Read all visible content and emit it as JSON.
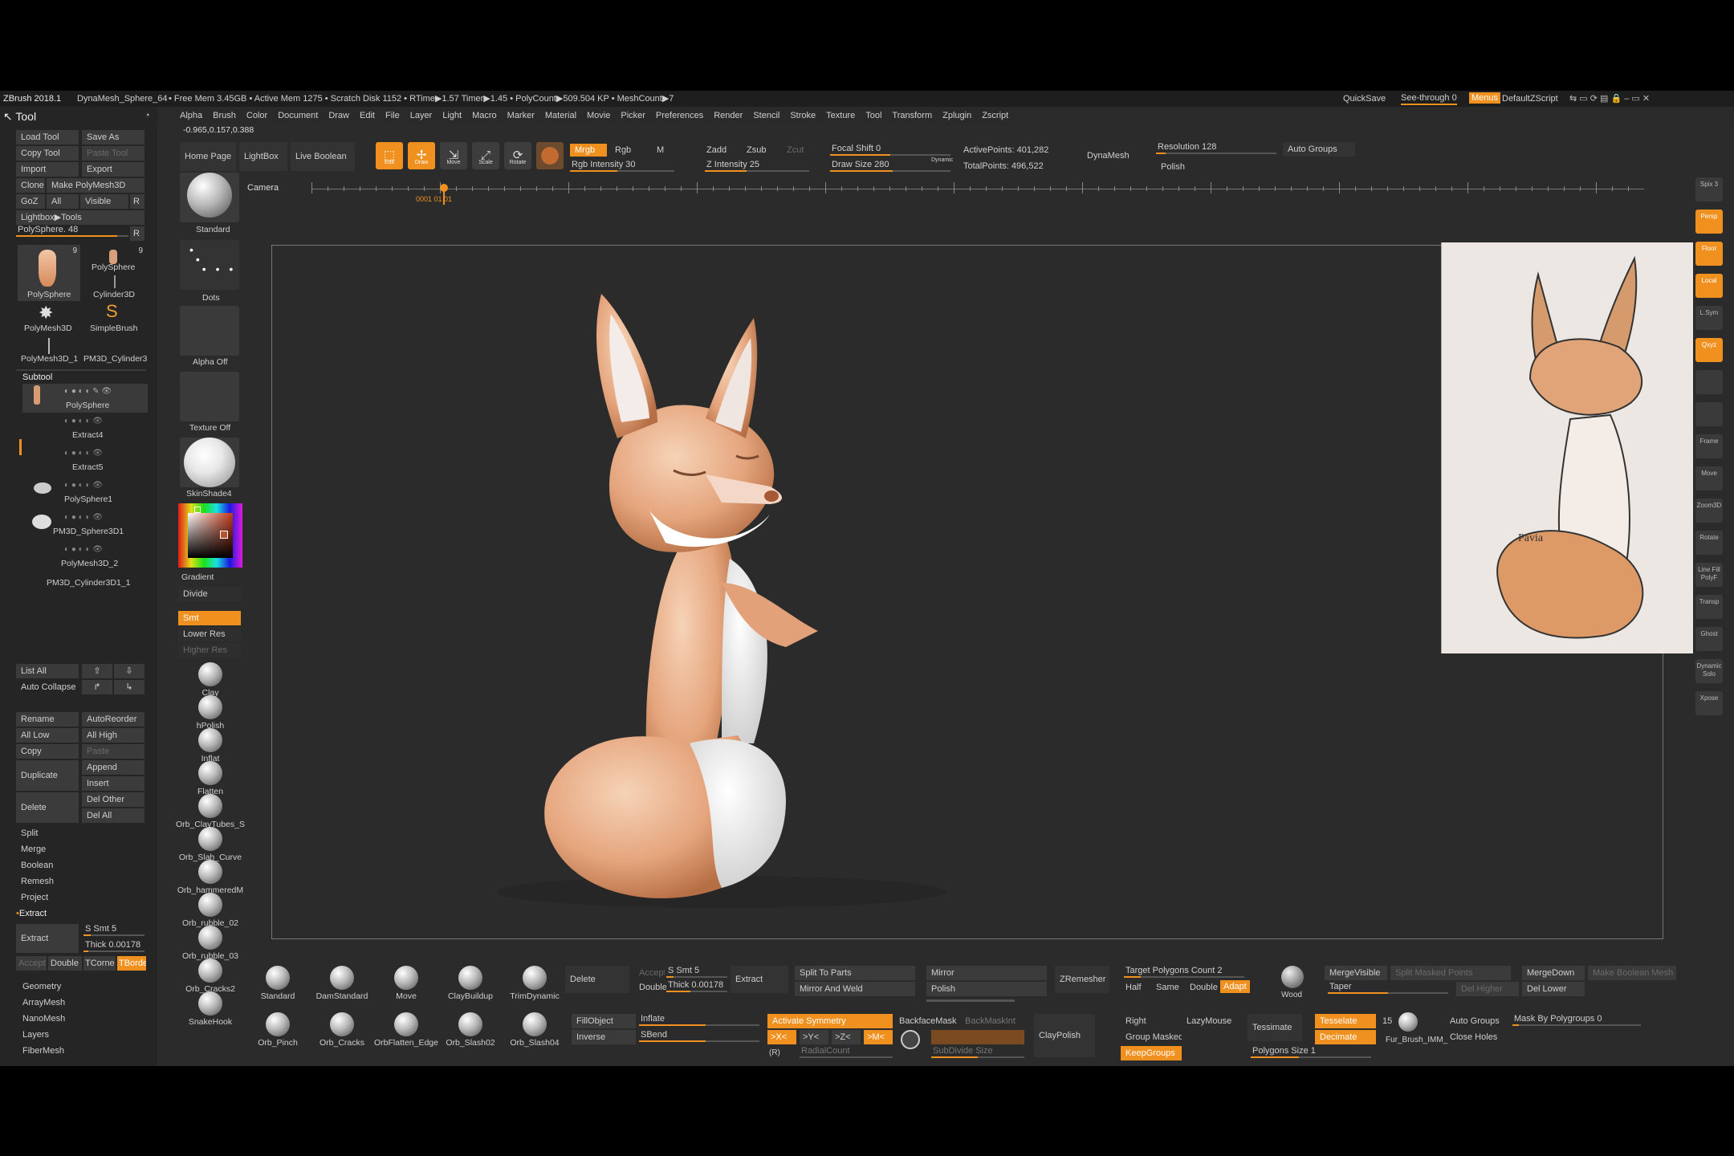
{
  "status": {
    "app": "ZBrush 2018.1",
    "file": "DynaMesh_Sphere_64",
    "stats": "• Free Mem 3.45GB • Active Mem 1275 • Scratch Disk 1152 • RTime▶1.57 Timer▶1.45 • PolyCount▶509.504 KP • MeshCount▶7",
    "quicksave": "QuickSave",
    "seethrough": "See-through",
    "seethrough_val": "0",
    "menus": "Menus",
    "script": "DefaultZScript"
  },
  "tool_title": "Tool",
  "coords": "-0.965,0.157,0.388",
  "menus": [
    "Alpha",
    "Brush",
    "Color",
    "Document",
    "Draw",
    "Edit",
    "File",
    "Layer",
    "Light",
    "Macro",
    "Marker",
    "Material",
    "Movie",
    "Picker",
    "Preferences",
    "Render",
    "Stencil",
    "Stroke",
    "Texture",
    "Tool",
    "Transform",
    "Zplugin",
    "Zscript"
  ],
  "left": {
    "load_tool": "Load Tool",
    "save_as": "Save As",
    "copy_tool": "Copy Tool",
    "paste_tool": "Paste Tool",
    "import": "Import",
    "export": "Export",
    "clone": "Clone",
    "make_polymesh": "Make PolyMesh3D",
    "goz": "GoZ",
    "all": "All",
    "visible": "Visible",
    "r": "R",
    "lightbox_tools": "Lightbox▶Tools",
    "polysphere_slider": "PolySphere. 48",
    "tools": [
      "PolySphere",
      "PolySphere",
      "Cylinder3D",
      "PolyMesh3D",
      "SimpleBrush",
      "PolyMesh3D_1",
      "PM3D_Cylinder3"
    ],
    "tool_counts": [
      "9",
      "9"
    ],
    "subtool": "Subtool",
    "subtools": [
      "PolySphere",
      "Extract4",
      "Extract5",
      "PolySphere1",
      "PM3D_Sphere3D1",
      "PolyMesh3D_2",
      "PM3D_Cylinder3D1_1"
    ],
    "list_all": "List All",
    "auto_collapse": "Auto Collapse",
    "rename": "Rename",
    "autoreorder": "AutoReorder",
    "all_low": "All Low",
    "all_high": "All High",
    "copy": "Copy",
    "paste": "Paste",
    "duplicate": "Duplicate",
    "append": "Append",
    "insert": "Insert",
    "delete": "Delete",
    "del_other": "Del Other",
    "del_all": "Del All",
    "sections": [
      "Split",
      "Merge",
      "Boolean",
      "Remesh",
      "Project",
      "Extract"
    ],
    "extract": "Extract",
    "smt": "S Smt 5",
    "thick": "Thick 0.00178",
    "accept": "Accept",
    "double": "Double",
    "tcorne": "TCorne",
    "tborder": "TBorde",
    "bottom": [
      "Geometry",
      "ArrayMesh",
      "NanoMesh",
      "Layers",
      "FiberMesh"
    ]
  },
  "shelf": {
    "standard": "Standard",
    "dots": "Dots",
    "alpha_off": "Alpha Off",
    "texture_off": "Texture Off",
    "material": "SkinShade4",
    "gradient": "Gradient",
    "divide": "Divide",
    "smt": "Smt",
    "lower_res": "Lower Res",
    "higher_res": "Higher Res",
    "brushes": [
      "Clay",
      "hPolish",
      "Inflat",
      "Flatten",
      "Orb_ClayTubes_S",
      "Orb_Slah_Curve",
      "Orb_hammeredM",
      "Orb_rubble_02",
      "Orb_rubble_03",
      "Orb_Cracks2",
      "SnakeHook"
    ]
  },
  "top": {
    "home": "Home Page",
    "lightbox": "LightBox",
    "live_boolean": "Live Boolean",
    "edit": "Edit",
    "draw": "Draw",
    "move": "Move",
    "scale": "Scale",
    "rotate": "Rotate",
    "mrgb": "Mrgb",
    "rgb": "Rgb",
    "m": "M",
    "rgb_int": "Rgb Intensity 30",
    "zadd": "Zadd",
    "zsub": "Zsub",
    "zcut": "Zcut",
    "z_int": "Z Intensity 25",
    "focal": "Focal Shift 0",
    "draw_size": "Draw Size 280",
    "dynamic": "Dynamic",
    "active_points": "ActivePoints: 401,282",
    "total_points": "TotalPoints: 496,522",
    "dynamesh": "DynaMesh",
    "resolution": "Resolution 128",
    "polish": "Polish",
    "auto_groups": "Auto Groups"
  },
  "timeline": {
    "camera": "Camera",
    "marker": "0001 01 01"
  },
  "right": [
    "Spix 3",
    "Persp",
    "Floor",
    "Local",
    "L.Sym",
    "Qxyz",
    "",
    "",
    "Frame",
    "Move",
    "Zoom3D",
    "Rotate",
    "Line Fill PolyF",
    "Transp",
    "Ghost",
    "Dynamic Solo",
    "Xpose"
  ],
  "bottom": {
    "brushes": [
      "Standard",
      "DamStandard",
      "Move",
      "ClayBuildup",
      "TrimDynamic"
    ],
    "brushes2": [
      "Orb_Pinch",
      "Orb_Cracks",
      "OrbFlatten_Edge",
      "Orb_Slash02",
      "Orb_Slash04"
    ],
    "delete": "Delete",
    "accept": "Accept",
    "smt": "S Smt 5",
    "double": "Double",
    "thick": "Thick 0.00178",
    "extract": "Extract",
    "fillobject": "FillObject",
    "inverse": "Inverse",
    "inflate": "Inflate",
    "sbend": "SBend",
    "split_parts": "Split To Parts",
    "mirror": "Mirror",
    "mirror_weld": "Mirror And Weld",
    "zremesher": "ZRemesher",
    "target": "Target Polygons Count 2",
    "half": "Half",
    "same": "Same",
    "dbl": "Double",
    "adapt": "Adapt",
    "activate_sym": "Activate Symmetry",
    "x": ">X<",
    "y": ">Y<",
    "z": ">Z<",
    "m": ">M<",
    "r": "(R)",
    "radialcount": "RadialCount",
    "backface": "BackfaceMask",
    "backmaskint": "BackMaskInt",
    "polish": "Polish",
    "subdivide": "SubDivide Size",
    "claypolish": "ClayPolish",
    "right": "Right",
    "group_masked": "Group Masked",
    "keepgroups": "KeepGroups",
    "lazymouse": "LazyMouse",
    "wood": "Wood",
    "mergevisible": "MergeVisible",
    "split_masked": "Split Masked Points",
    "mergedown": "MergeDown",
    "make_boolean": "Make Boolean Mesh",
    "taper": "Taper",
    "del_higher": "Del Higher",
    "del_lower": "Del Lower",
    "tessimate": "Tessimate",
    "tessellate": "Tesselate",
    "decimate": "Decimate",
    "fur_count": "15",
    "fur_brush": "Fur_Brush_IMM_",
    "auto_groups": "Auto Groups",
    "close_holes": "Close Holes",
    "mask_polygroups": "Mask By Polygroups 0",
    "polygons_size": "Polygons Size 1"
  },
  "colors": {
    "accent": "#f0901e",
    "bg": "#2b2b2b",
    "panel": "#3b3b3b"
  }
}
